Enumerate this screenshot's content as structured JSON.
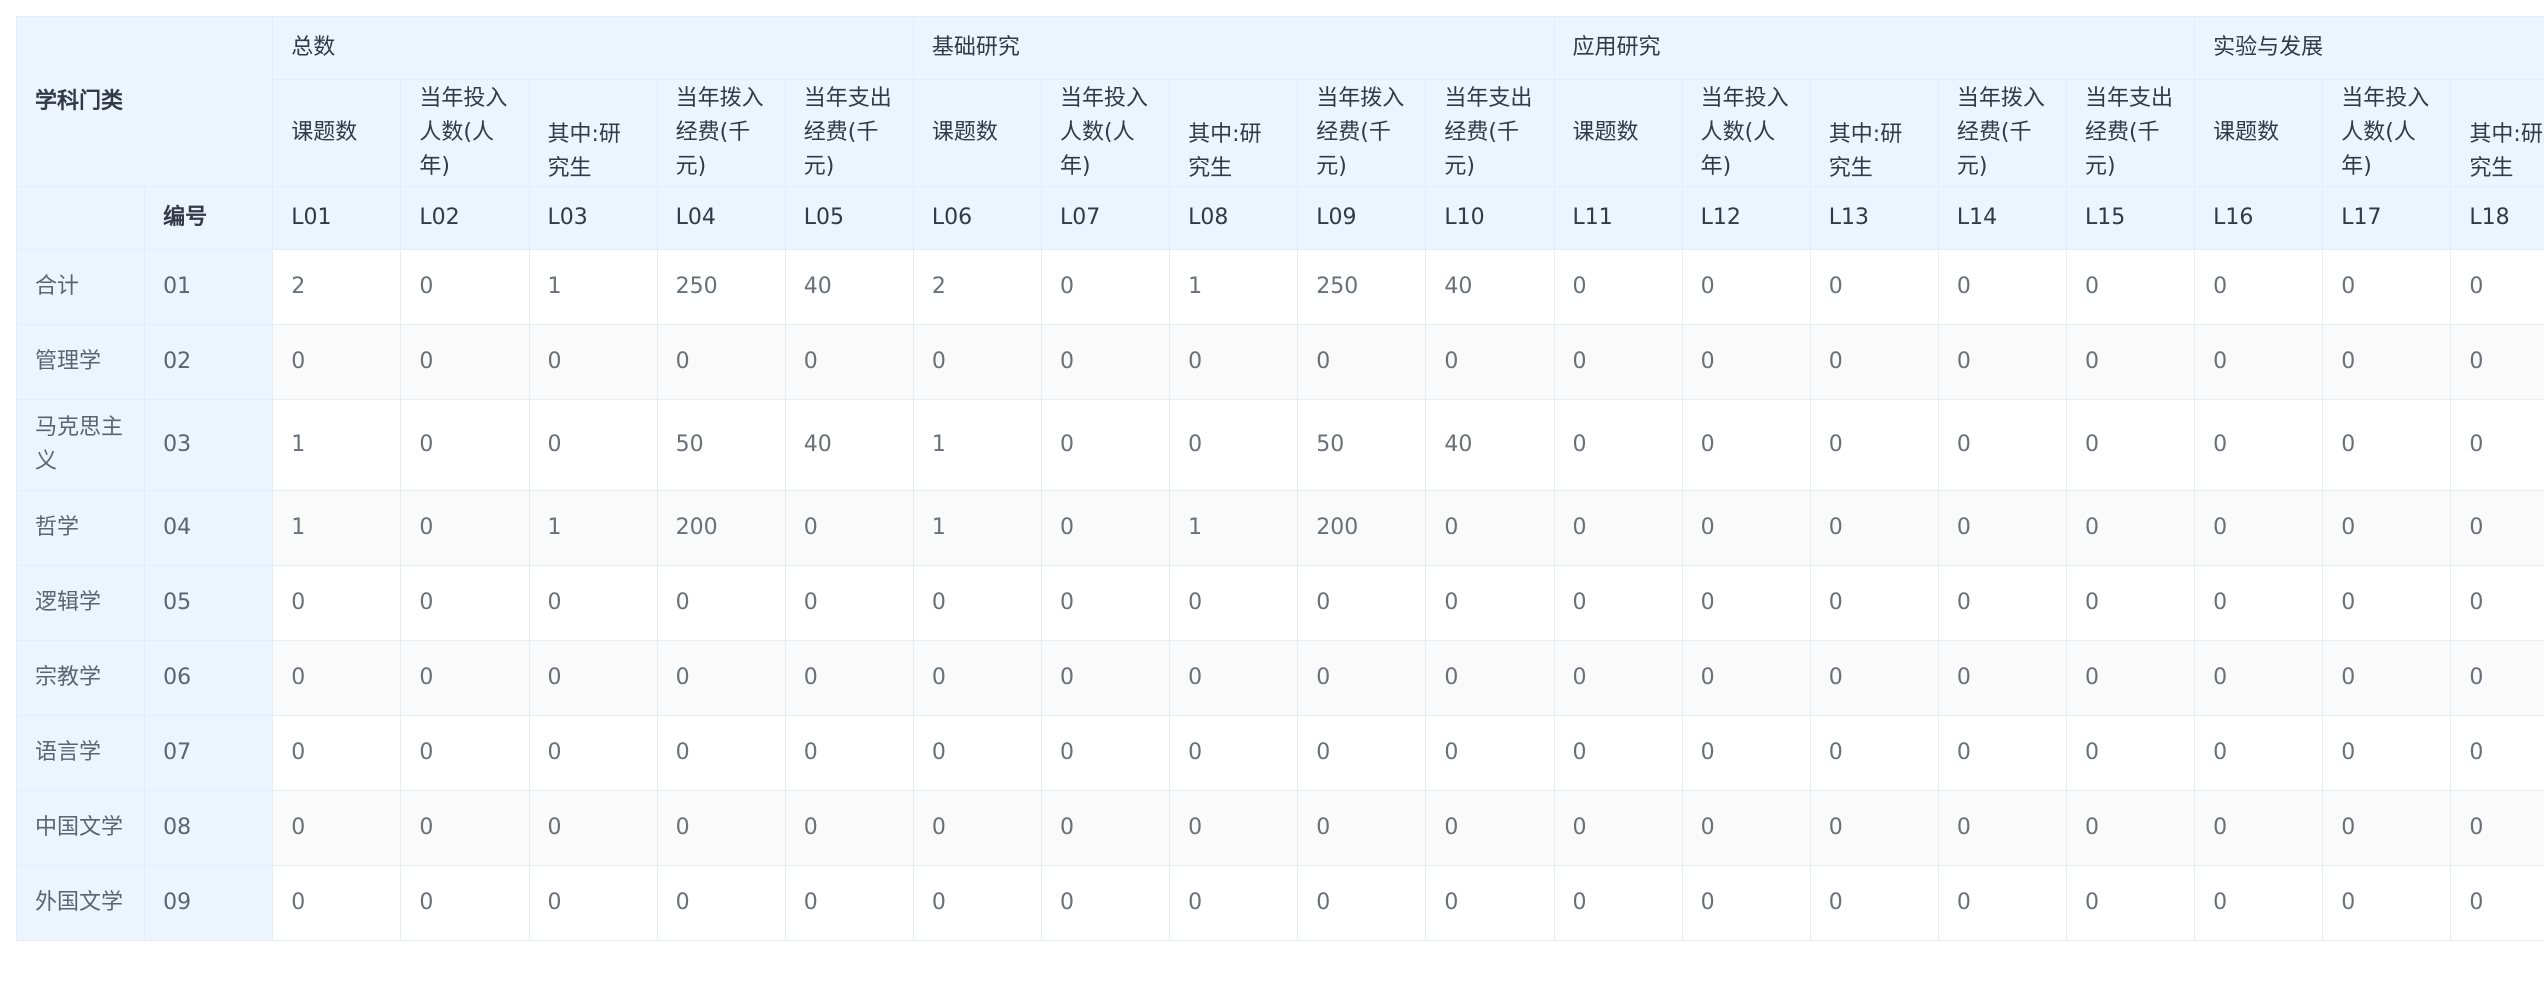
{
  "table": {
    "corner_label": "学科门类",
    "code_label": "编号",
    "groups": [
      "总数",
      "基础研究",
      "应用研究",
      "实验与发展"
    ],
    "sub_headers": {
      "topics": "课题数",
      "people": "当年投入人数(人年)",
      "grad": "其中:研究生",
      "funds_in": "当年拨入经费(千元)",
      "funds_out": "当年支出经费(千元)"
    },
    "codes": [
      "L01",
      "L02",
      "L03",
      "L04",
      "L05",
      "L06",
      "L07",
      "L08",
      "L09",
      "L10",
      "L11",
      "L12",
      "L13",
      "L14",
      "L15",
      "L16",
      "L17",
      "L18"
    ],
    "rows": [
      {
        "name": "合计",
        "code": "01",
        "values": [
          "2",
          "0",
          "1",
          "250",
          "40",
          "2",
          "0",
          "1",
          "250",
          "40",
          "0",
          "0",
          "0",
          "0",
          "0",
          "0",
          "0",
          "0"
        ]
      },
      {
        "name": "管理学",
        "code": "02",
        "values": [
          "0",
          "0",
          "0",
          "0",
          "0",
          "0",
          "0",
          "0",
          "0",
          "0",
          "0",
          "0",
          "0",
          "0",
          "0",
          "0",
          "0",
          "0"
        ]
      },
      {
        "name": "马克思主义",
        "code": "03",
        "values": [
          "1",
          "0",
          "0",
          "50",
          "40",
          "1",
          "0",
          "0",
          "50",
          "40",
          "0",
          "0",
          "0",
          "0",
          "0",
          "0",
          "0",
          "0"
        ]
      },
      {
        "name": "哲学",
        "code": "04",
        "values": [
          "1",
          "0",
          "1",
          "200",
          "0",
          "1",
          "0",
          "1",
          "200",
          "0",
          "0",
          "0",
          "0",
          "0",
          "0",
          "0",
          "0",
          "0"
        ]
      },
      {
        "name": "逻辑学",
        "code": "05",
        "values": [
          "0",
          "0",
          "0",
          "0",
          "0",
          "0",
          "0",
          "0",
          "0",
          "0",
          "0",
          "0",
          "0",
          "0",
          "0",
          "0",
          "0",
          "0"
        ]
      },
      {
        "name": "宗教学",
        "code": "06",
        "values": [
          "0",
          "0",
          "0",
          "0",
          "0",
          "0",
          "0",
          "0",
          "0",
          "0",
          "0",
          "0",
          "0",
          "0",
          "0",
          "0",
          "0",
          "0"
        ]
      },
      {
        "name": "语言学",
        "code": "07",
        "values": [
          "0",
          "0",
          "0",
          "0",
          "0",
          "0",
          "0",
          "0",
          "0",
          "0",
          "0",
          "0",
          "0",
          "0",
          "0",
          "0",
          "0",
          "0"
        ]
      },
      {
        "name": "中国文学",
        "code": "08",
        "values": [
          "0",
          "0",
          "0",
          "0",
          "0",
          "0",
          "0",
          "0",
          "0",
          "0",
          "0",
          "0",
          "0",
          "0",
          "0",
          "0",
          "0",
          "0"
        ]
      },
      {
        "name": "外国文学",
        "code": "09",
        "values": [
          "0",
          "0",
          "0",
          "0",
          "0",
          "0",
          "0",
          "0",
          "0",
          "0",
          "0",
          "0",
          "0",
          "0",
          "0",
          "0",
          "0",
          "0"
        ]
      }
    ]
  }
}
